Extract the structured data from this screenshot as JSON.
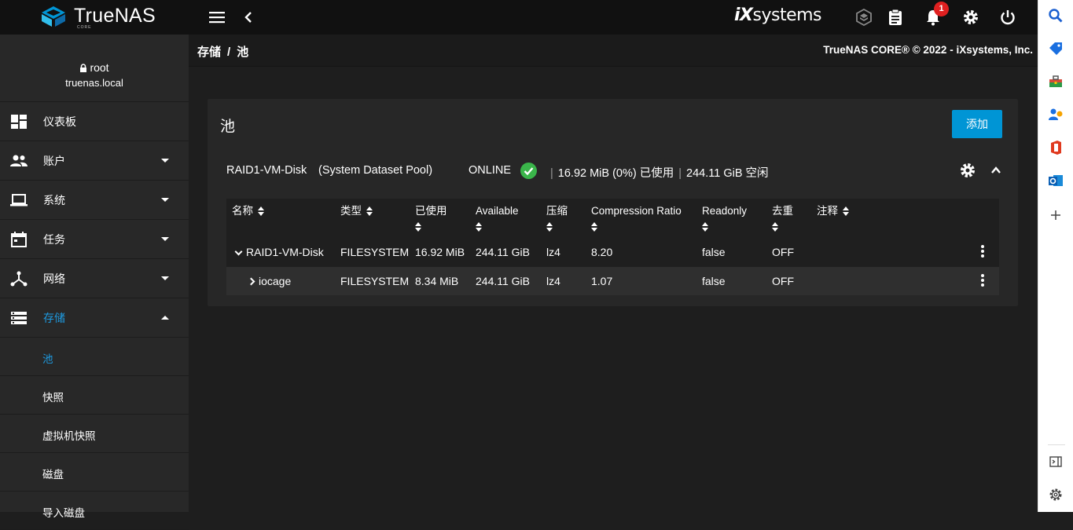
{
  "brand": {
    "name_a": "True",
    "name_b": "NAS",
    "edition": "CORE",
    "vendor_logo_a": "iX",
    "vendor_logo_b": "systems"
  },
  "notifications": {
    "count": "1"
  },
  "breadcrumb": {
    "section": "存储",
    "separator": "/",
    "current": "池"
  },
  "copyright": "TrueNAS CORE® © 2022 - iXsystems, Inc.",
  "user": {
    "name": "root",
    "host": "truenas.local"
  },
  "sidebar": {
    "items": [
      {
        "label": "仪表板",
        "icon": "dashboard-icon"
      },
      {
        "label": "账户",
        "icon": "people-icon"
      },
      {
        "label": "系统",
        "icon": "laptop-icon"
      },
      {
        "label": "任务",
        "icon": "calendar-icon"
      },
      {
        "label": "网络",
        "icon": "network-icon"
      },
      {
        "label": "存储",
        "icon": "storage-icon"
      }
    ],
    "sub_items": [
      {
        "label": "池"
      },
      {
        "label": "快照"
      },
      {
        "label": "虚拟机快照"
      },
      {
        "label": "磁盘"
      },
      {
        "label": "导入磁盘"
      }
    ]
  },
  "pools": {
    "title": "池",
    "add_label": "添加",
    "pool": {
      "name": "RAID1-VM-Disk",
      "tag": "(System Dataset Pool)",
      "status": "ONLINE",
      "used": "16.92 MiB (0%) 已使用",
      "free": "244.11 GiB 空闲"
    },
    "columns": [
      "名称",
      "类型",
      "已使用",
      "Available",
      "压缩",
      "Compression Ratio",
      "Readonly",
      "去重",
      "注释"
    ],
    "rows": [
      {
        "name": "RAID1-VM-Disk",
        "type": "FILESYSTEM",
        "used": "16.92 MiB",
        "available": "244.11 GiB",
        "compression": "lz4",
        "ratio": "8.20",
        "readonly": "false",
        "dedup": "OFF"
      },
      {
        "name": "iocage",
        "type": "FILESYSTEM",
        "used": "8.34 MiB",
        "available": "244.11 GiB",
        "compression": "lz4",
        "ratio": "1.07",
        "readonly": "false",
        "dedup": "OFF"
      }
    ]
  },
  "colors": {
    "accent": "#0095d5",
    "active_nav": "#1e9ae0",
    "online": "#3ab54a",
    "badge": "#e02020"
  }
}
